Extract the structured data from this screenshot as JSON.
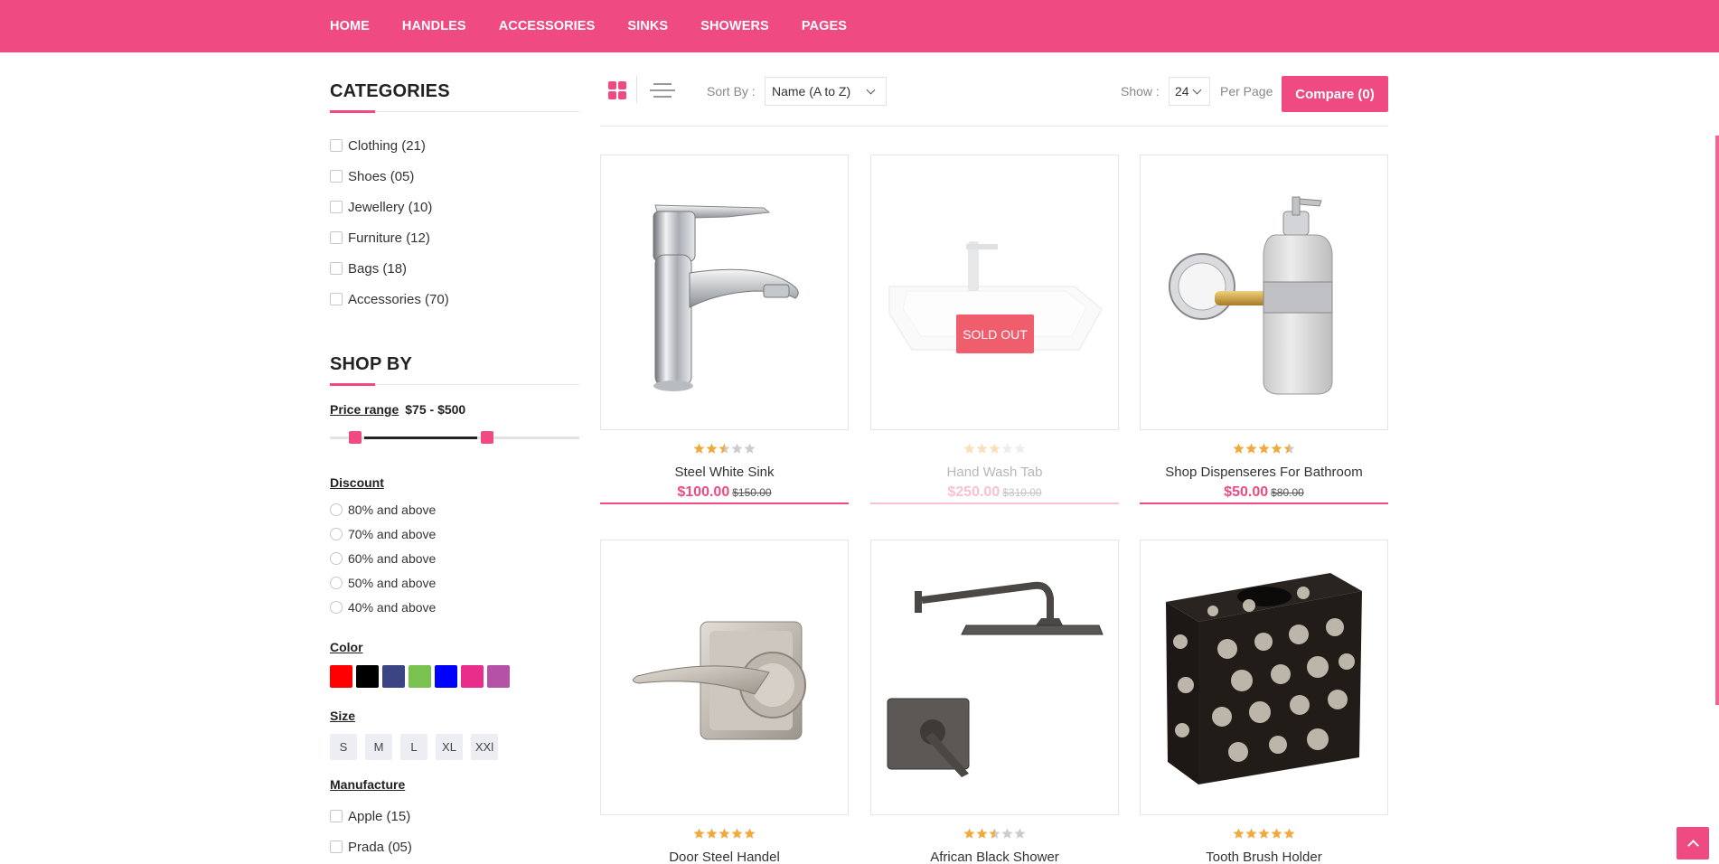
{
  "nav": {
    "items": [
      "HOME",
      "HANDLES",
      "ACCESSORIES",
      "SINKS",
      "SHOWERS",
      "PAGES"
    ]
  },
  "sidebar": {
    "categories": {
      "title": "CATEGORIES",
      "items": [
        "Clothing (21)",
        "Shoes (05)",
        "Jewellery (10)",
        "Furniture (12)",
        "Bags (18)",
        "Accessories (70)"
      ]
    },
    "shop_by": {
      "title": "SHOP BY",
      "price_label": "Price range",
      "price_value": "$75 - $500",
      "discount_label": "Discount",
      "discounts": [
        "80% and above",
        "70% and above",
        "60% and above",
        "50% and above",
        "40% and above"
      ],
      "color_label": "Color",
      "colors": [
        "#ff0000",
        "#000000",
        "#3b4583",
        "#7ac14f",
        "#0000ff",
        "#e82d8a",
        "#b651a8"
      ],
      "size_label": "Size",
      "sizes": [
        "S",
        "M",
        "L",
        "XL",
        "XXl"
      ],
      "manufacture_label": "Manufacture",
      "manufacturers": [
        "Apple (15)",
        "Prada (05)"
      ]
    }
  },
  "toolbar": {
    "sort_label": "Sort By :",
    "sort_value": "Name (A to Z)",
    "show_label": "Show :",
    "show_value": "24",
    "per_page": "Per Page",
    "compare": "Compare (0)"
  },
  "products": [
    {
      "name": "Steel White Sink",
      "price": "$100.00",
      "old_price": "$150.00",
      "rating": 2.5
    },
    {
      "name": "Hand Wash Tab",
      "price": "$250.00",
      "old_price": "$310.00",
      "rating": 3,
      "badge": "SOLD OUT"
    },
    {
      "name": "Shop Dispenseres For Bathroom",
      "price": "$50.00",
      "old_price": "$80.00",
      "rating": 4.5
    },
    {
      "name": "Door Steel Handel",
      "rating": 5
    },
    {
      "name": "African Black Shower",
      "rating": 2.5
    },
    {
      "name": "Tooth Brush Holder",
      "rating": 5
    }
  ],
  "accent_color": "#ef4a81"
}
